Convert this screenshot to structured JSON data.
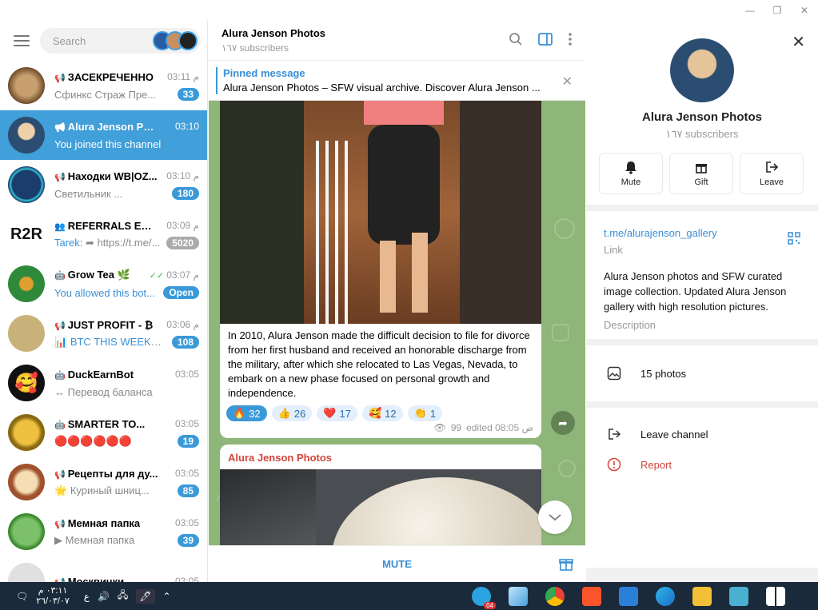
{
  "search": {
    "placeholder": "Search"
  },
  "chats": [
    {
      "name": "ЗАСЕКРЕЧЕННО",
      "time": "03:11",
      "preview": "Сфинкс Страж Пре...",
      "badge": "33",
      "color": "#8a6a3a",
      "initials": ""
    },
    {
      "name": "Alura Jenson Ph...",
      "time": "03:10",
      "preview": "You joined this channel",
      "badge": "",
      "color": "#c98f5f",
      "initials": ""
    },
    {
      "name": "Находки WB|OZ...",
      "time": "03:10",
      "preview": "Светильник ...",
      "badge": "180",
      "color": "#1b3d6e",
      "initials": ""
    },
    {
      "name": "REFERRALS EXC...",
      "time": "03:09",
      "preview_sender": "Tarek:",
      "preview": "https://t.me/...",
      "badge": "5020",
      "color": "#ffffff",
      "initials": "R2R"
    },
    {
      "name": "Grow Tea",
      "time": "03:07",
      "preview": "You allowed this bot...",
      "badge": "Open",
      "color": "#2e8a3a",
      "initials": ""
    },
    {
      "name": "JUST PROFIT - ₿",
      "time": "03:06",
      "preview": "BTC THIS WEEKEN...",
      "badge": "108",
      "color": "#c9b27a",
      "initials": ""
    },
    {
      "name": "DuckEarnBot",
      "time": "03:05",
      "preview": "Перевод баланса",
      "badge": "",
      "color": "#111111",
      "initials": ""
    },
    {
      "name": "SMARTER TO...",
      "time": "03:05",
      "preview": "🔴🔴🔴🔴🔴🔴",
      "badge": "19",
      "color": "#c9a03a",
      "initials": ""
    },
    {
      "name": "Рецепты для ду...",
      "time": "03:05",
      "preview": "Куриный шниц...",
      "badge": "85",
      "color": "#a0522d",
      "initials": ""
    },
    {
      "name": "Мемная папка",
      "time": "03:05",
      "preview": "Мемная папка",
      "badge": "39",
      "color": "#4caf50",
      "initials": ""
    },
    {
      "name": "Москвички",
      "time": "03:05",
      "preview": "",
      "badge": "",
      "color": "#e0e0e0",
      "initials": ""
    }
  ],
  "chat_time_prefix": "م",
  "channel": {
    "title": "Alura Jenson Photos",
    "subscribers": "١٦٧ subscribers"
  },
  "pinned": {
    "title": "Pinned message",
    "text": "Alura Jenson Photos – SFW visual archive. Discover Alura Jenson ..."
  },
  "message1": {
    "text": "In 2010, Alura Jenson made the difficult decision to file for divorce from her first husband and received an honorable discharge from the military, after which she relocated to Las Vegas, Nevada, to embark on a new phase focused on personal growth and independence.",
    "reactions": [
      {
        "emoji": "🔥",
        "count": "32"
      },
      {
        "emoji": "👍",
        "count": "26"
      },
      {
        "emoji": "❤️",
        "count": "17"
      },
      {
        "emoji": "🥰",
        "count": "12"
      },
      {
        "emoji": "👏",
        "count": "1"
      }
    ],
    "views": "99",
    "edited": "edited 08:05 ص"
  },
  "message2": {
    "author": "Alura Jenson Photos"
  },
  "bottom": {
    "mute_label": "MUTE"
  },
  "profile": {
    "name": "Alura Jenson Photos",
    "subscribers": "١٦٧ subscribers",
    "actions": [
      {
        "label": "Mute"
      },
      {
        "label": "Gift"
      },
      {
        "label": "Leave"
      }
    ],
    "link": "t.me/alurajenson_gallery",
    "link_label": "Link",
    "description": "Alura Jenson photos and SFW curated image collection. Updated Alura Jenson gallery with high resolution pictures.",
    "description_label": "Description",
    "media": "15 photos",
    "leave_channel": "Leave channel",
    "report": "Report"
  },
  "taskbar": {
    "time": "٠٣:١١ م",
    "date": "٢٦/٠٣/٠٧",
    "lang": "ع",
    "telegram_badge": "04"
  }
}
